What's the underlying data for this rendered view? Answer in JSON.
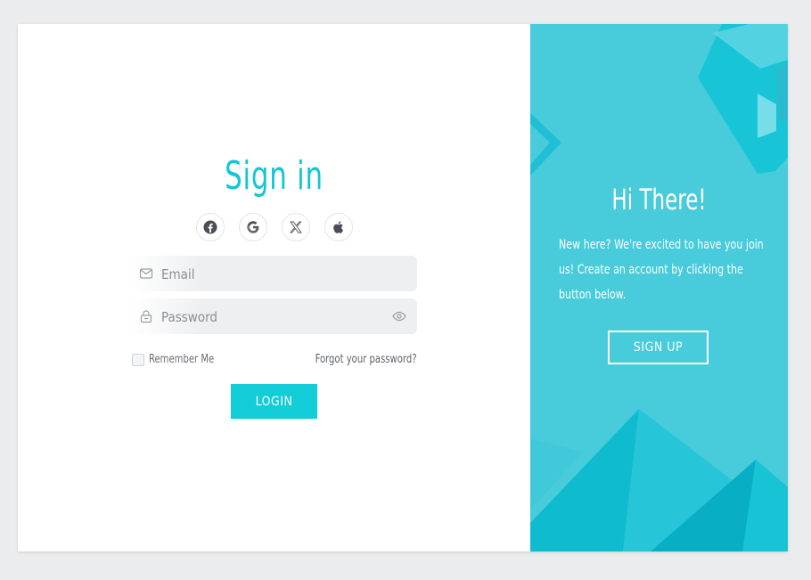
{
  "signin": {
    "title": "Sign in",
    "socials": [
      {
        "name": "facebook-icon"
      },
      {
        "name": "google-icon"
      },
      {
        "name": "x-icon"
      },
      {
        "name": "apple-icon"
      }
    ],
    "email_placeholder": "Email",
    "password_placeholder": "Password",
    "remember_label": "Remember Me",
    "forgot_label": "Forgot your password?",
    "login_label": "LOGIN"
  },
  "welcome": {
    "title": "Hi There!",
    "description": "New here? We're excited to have you join us! Create an account by clicking the button below.",
    "signup_label": "SIGN UP"
  },
  "colors": {
    "accent": "#13c6d4",
    "panel": "#48cbdb",
    "background": "#ebecee"
  }
}
